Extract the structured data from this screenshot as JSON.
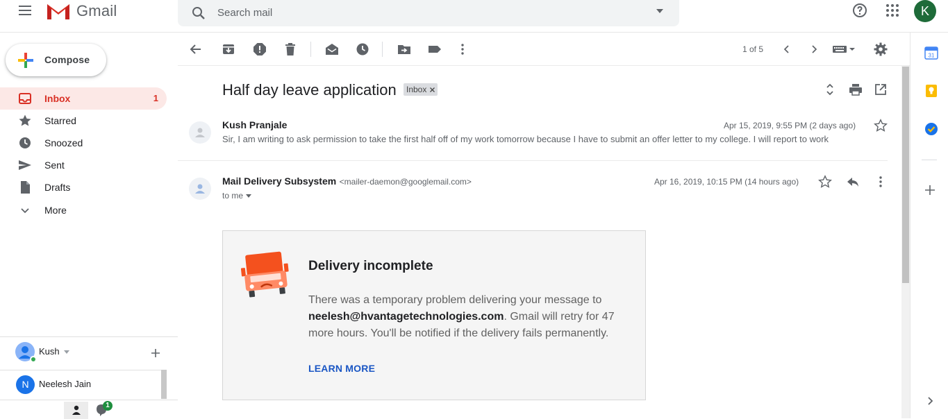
{
  "header": {
    "app_name": "Gmail",
    "search_placeholder": "Search mail",
    "account_initial": "K"
  },
  "sidebar": {
    "compose_label": "Compose",
    "items": [
      {
        "label": "Inbox",
        "count": "1",
        "icon": "inbox-icon",
        "active": true
      },
      {
        "label": "Starred",
        "count": "",
        "icon": "star-icon"
      },
      {
        "label": "Snoozed",
        "count": "",
        "icon": "clock-icon"
      },
      {
        "label": "Sent",
        "count": "",
        "icon": "send-icon"
      },
      {
        "label": "Drafts",
        "count": "",
        "icon": "draft-icon"
      },
      {
        "label": "More",
        "count": "",
        "icon": "chevron-down-icon"
      }
    ]
  },
  "hangouts": {
    "user_name": "Kush",
    "contact_initial": "N",
    "contact_name": "Neelesh Jain",
    "chat_badge": "1"
  },
  "toolbar": {
    "pager": "1 of 5"
  },
  "thread": {
    "subject": "Half day leave application",
    "label_chip": "Inbox",
    "messages": [
      {
        "sender": "Kush Pranjale",
        "date": "Apr 15, 2019, 9:55 PM (2 days ago)",
        "snippet": "Sir, I am writing to ask permission to take the first half off of my work tomorrow because I have to submit an offer letter to my college. I will report to work"
      },
      {
        "sender": "Mail Delivery Subsystem",
        "email": "<mailer-daemon@googlemail.com>",
        "date": "Apr 16, 2019, 10:15 PM (14 hours ago)",
        "recipient": "to me"
      }
    ]
  },
  "delivery_card": {
    "title": "Delivery incomplete",
    "body_prefix": "There was a temporary problem delivering your message to ",
    "recipient_email": "neelesh@hvantagetechnologies.com",
    "body_suffix": ". Gmail will retry for 47 more hours. You'll be notified if the delivery fails permanently.",
    "link_label": "LEARN MORE"
  },
  "colors": {
    "accent_red": "#d93025",
    "link_blue": "#1a56c4",
    "avatar_green": "#1e6b39",
    "truck_orange": "#f4511e"
  }
}
